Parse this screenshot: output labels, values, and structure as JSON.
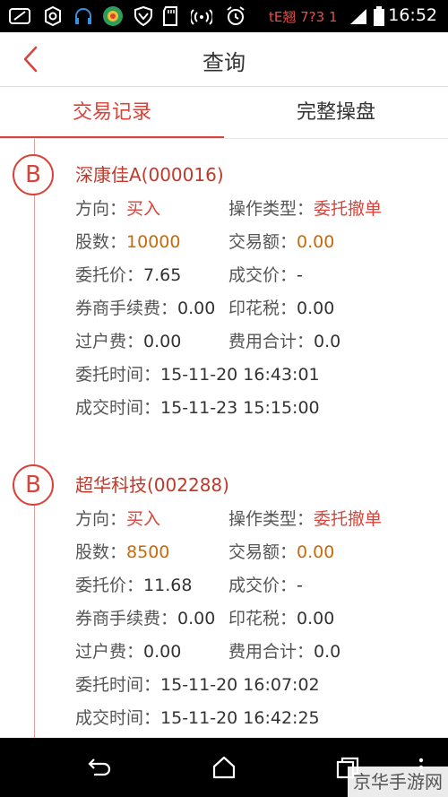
{
  "status_bar": {
    "time": "16:52",
    "carrier": "tE翘 7?3 1",
    "icons": [
      "notification-icon",
      "settings-icon",
      "headset-icon",
      "app-store-icon",
      "shield-icon",
      "sd-card-icon",
      "wireless-icon",
      "alarm-icon",
      "signal-icon",
      "battery-icon"
    ]
  },
  "nav": {
    "title": "查询",
    "back_icon": "back-arrow-icon"
  },
  "tabs": [
    {
      "label": "交易记录",
      "active": true
    },
    {
      "label": "完整操盘",
      "active": false
    }
  ],
  "records": [
    {
      "badge": "B",
      "stock": "深康佳A(000016)",
      "direction_label": "方向：",
      "direction": "买入",
      "op_type_label": "操作类型：",
      "op_type": "委托撤单",
      "shares_label": "股数：",
      "shares": "10000",
      "amount_label": "交易额：",
      "amount": "0.00",
      "order_price_label": "委托价：",
      "order_price": "7.65",
      "deal_price_label": "成交价：",
      "deal_price": "-",
      "commission_label": "券商手续费：",
      "commission": "0.00",
      "stamp_tax_label": "印花税：",
      "stamp_tax": "0.00",
      "transfer_fee_label": "过户费：",
      "transfer_fee": "0.00",
      "total_fee_label": "费用合计：",
      "total_fee": "0.0",
      "order_time_label": "委托时间：",
      "order_time": "15-11-20  16:43:01",
      "deal_time_label": "成交时间：",
      "deal_time": "15-11-23  15:15:00"
    },
    {
      "badge": "B",
      "stock": "超华科技(002288)",
      "direction_label": "方向：",
      "direction": "买入",
      "op_type_label": "操作类型：",
      "op_type": "委托撤单",
      "shares_label": "股数：",
      "shares": "8500",
      "amount_label": "交易额：",
      "amount": "0.00",
      "order_price_label": "委托价：",
      "order_price": "11.68",
      "deal_price_label": "成交价：",
      "deal_price": "-",
      "commission_label": "券商手续费：",
      "commission": "0.00",
      "stamp_tax_label": "印花税：",
      "stamp_tax": "0.00",
      "transfer_fee_label": "过户费：",
      "transfer_fee": "0.00",
      "total_fee_label": "费用合计：",
      "total_fee": "0.0",
      "order_time_label": "委托时间：",
      "order_time": "15-11-20  16:07:02",
      "deal_time_label": "成交时间：",
      "deal_time": "15-11-20  16:42:25"
    }
  ],
  "bottom_nav": {
    "back": "back-icon",
    "home": "home-icon",
    "recents": "recents-icon"
  },
  "watermark": "京华手游网",
  "colors": {
    "accent": "#d9433a",
    "value_orange": "#c86a0a",
    "timeline": "#e3a09b"
  }
}
